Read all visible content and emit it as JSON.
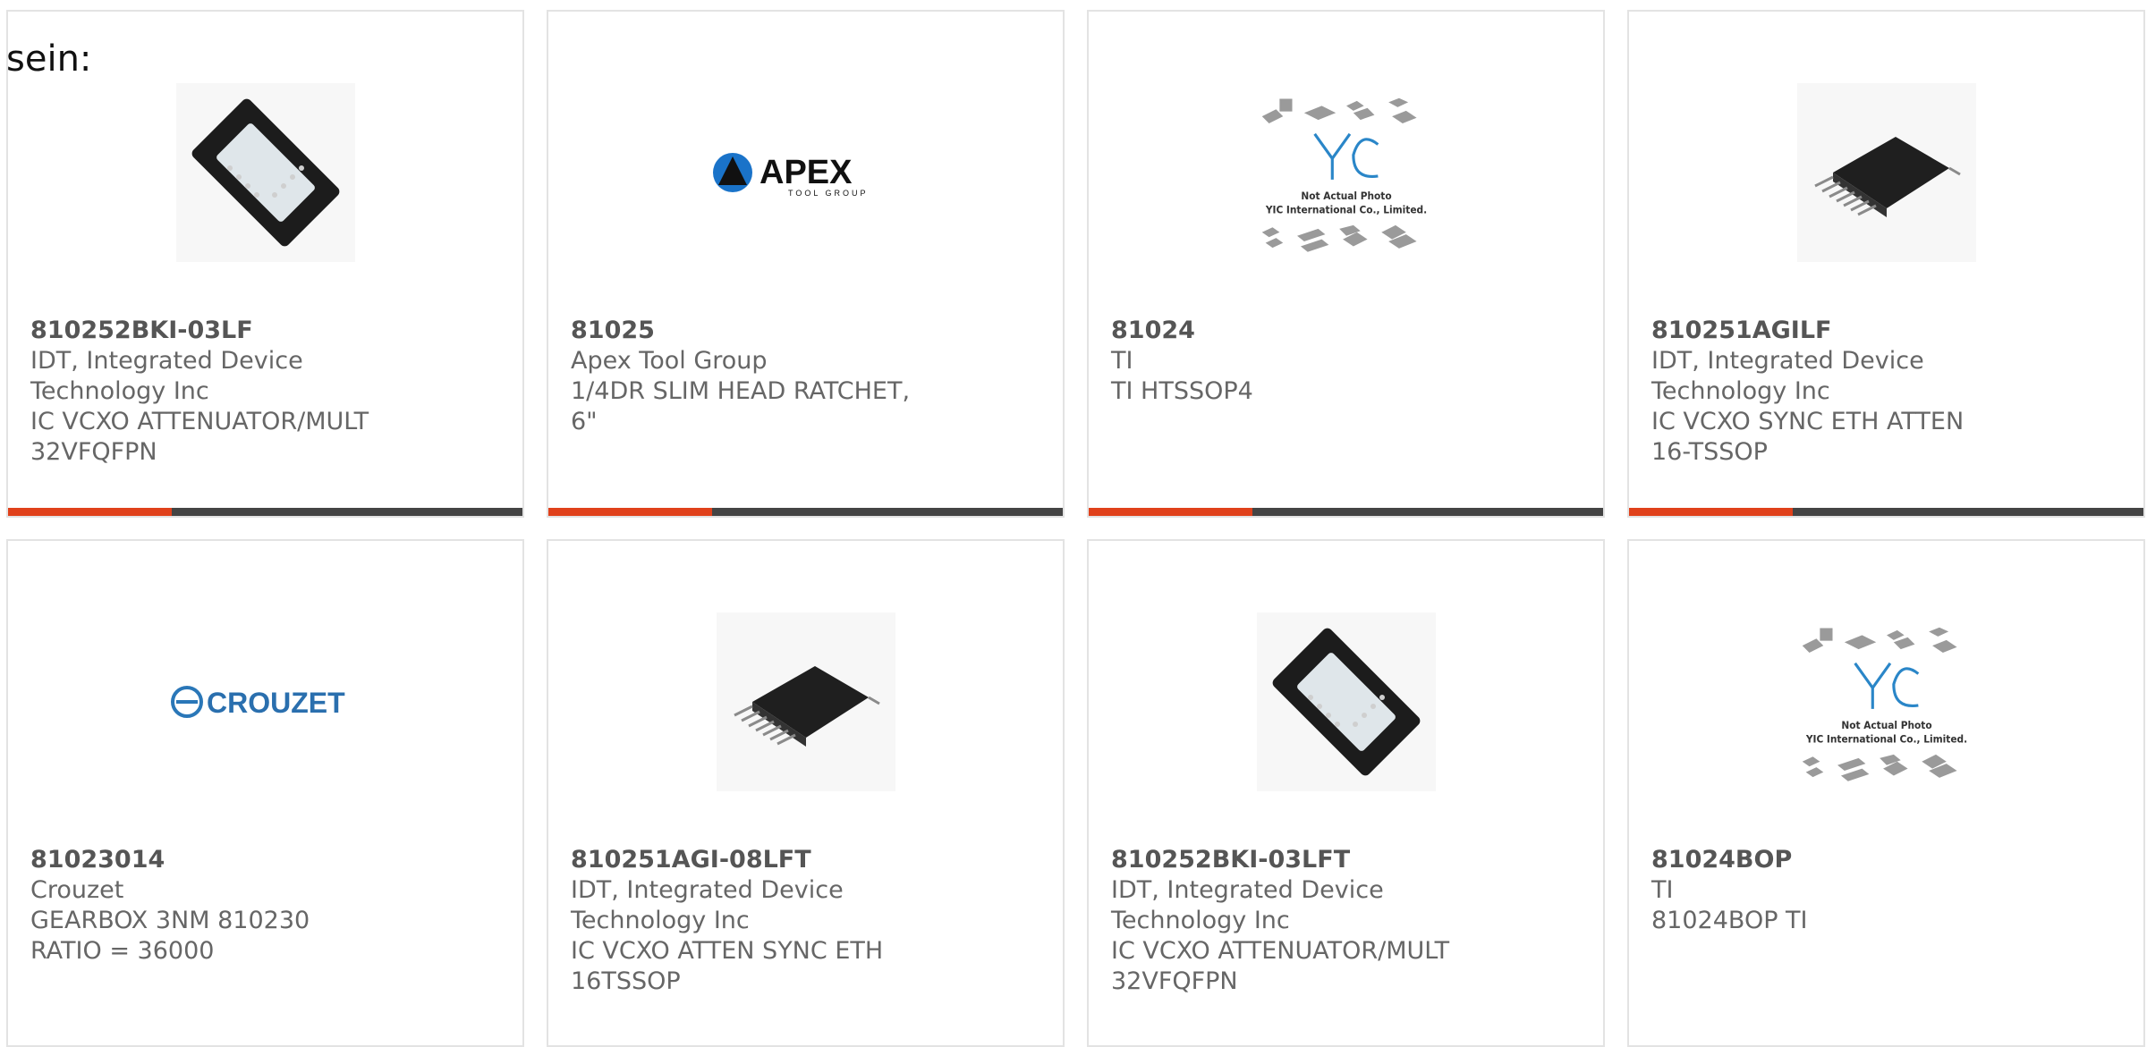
{
  "intro_text": "sein:",
  "accent_color": "#e0411b",
  "bar_color": "#444444",
  "products": [
    {
      "part_number": "810252BKI-03LF",
      "manufacturer": "IDT, Integrated Device Technology Inc",
      "description": "IC VCXO ATTENUATOR/MULT 32VFQFPN",
      "image": "qfn-chip-icon"
    },
    {
      "part_number": "81025",
      "manufacturer": "Apex Tool Group",
      "description": "1/4DR SLIM HEAD RATCHET, 6\"",
      "image": "apex-logo",
      "logo_text": "APEX",
      "logo_subtext": "TOOL GROUP"
    },
    {
      "part_number": "81024",
      "manufacturer": "TI",
      "description": "TI HTSSOP4",
      "image": "yic-placeholder",
      "placeholder_line1": "Not Actual Photo",
      "placeholder_line2": "YIC International Co., Limited."
    },
    {
      "part_number": "810251AGILF",
      "manufacturer": "IDT, Integrated Device Technology Inc",
      "description": "IC VCXO SYNC ETH ATTEN 16-TSSOP",
      "image": "tssop-chip-icon"
    },
    {
      "part_number": "81023014",
      "manufacturer": "Crouzet",
      "description": "GEARBOX 3NM 810230 RATIO = 36000",
      "image": "crouzet-logo",
      "logo_text": "CROUZET"
    },
    {
      "part_number": "810251AGI-08LFT",
      "manufacturer": "IDT, Integrated Device Technology Inc",
      "description": "IC VCXO ATTEN SYNC ETH 16TSSOP",
      "image": "tssop-chip-icon"
    },
    {
      "part_number": "810252BKI-03LFT",
      "manufacturer": "IDT, Integrated Device Technology Inc",
      "description": "IC VCXO ATTENUATOR/MULT 32VFQFPN",
      "image": "qfn-chip-icon"
    },
    {
      "part_number": "81024BOP",
      "manufacturer": "TI",
      "description": "81024BOP TI",
      "image": "yic-placeholder",
      "placeholder_line1": "Not Actual Photo",
      "placeholder_line2": "YIC International Co., Limited."
    }
  ]
}
